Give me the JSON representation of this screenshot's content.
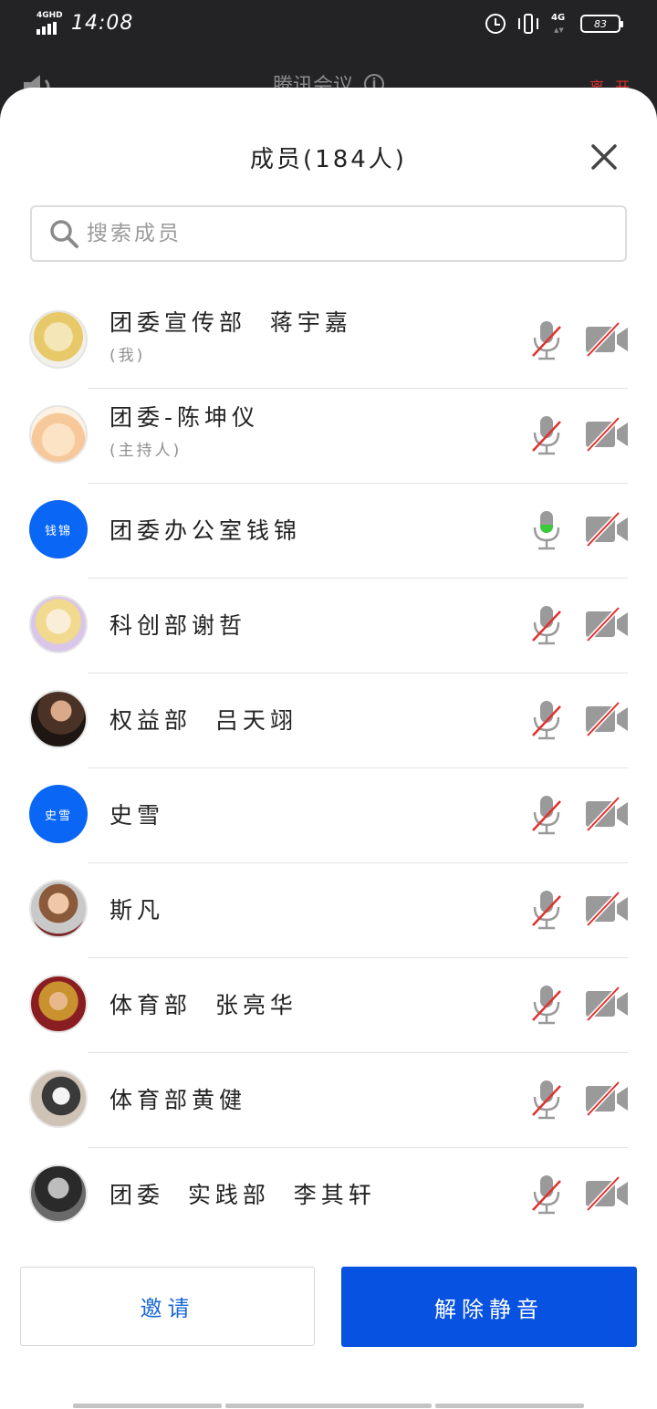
{
  "status_bar": {
    "network_label": "4GHD",
    "time": "14:08",
    "network_4g": "4G",
    "battery": "83"
  },
  "meeting": {
    "title": "腾讯会议",
    "leave_label": "离开"
  },
  "sheet": {
    "title": "成员(184人)",
    "search_placeholder": "搜索成员",
    "invite_label": "邀请",
    "unmute_label": "解除静音"
  },
  "colors": {
    "accent": "#0752e0",
    "avatar_blue": "#0a66f5",
    "muted_red": "#e0302d",
    "mic_active": "#3cc93c"
  },
  "members": [
    {
      "name": "团委宣传部  蒋宇嘉",
      "role": "(我)",
      "avatar": "anime-blonde",
      "mic": "muted",
      "camera": "off"
    },
    {
      "name": "团委-陈坤仪",
      "role": "(主持人)",
      "avatar": "anime-bunny",
      "mic": "muted",
      "camera": "off"
    },
    {
      "name": "团委办公室钱锦",
      "role": "",
      "avatar_text": "钱锦",
      "mic": "speaking",
      "camera": "off"
    },
    {
      "name": "科创部谢哲",
      "role": "",
      "avatar": "anime-sailor",
      "mic": "muted",
      "camera": "off"
    },
    {
      "name": "权益部  吕天翊",
      "role": "",
      "avatar": "photo-player",
      "mic": "muted",
      "camera": "off"
    },
    {
      "name": "史雪",
      "role": "",
      "avatar_text": "史雪",
      "mic": "muted",
      "camera": "off"
    },
    {
      "name": "斯凡",
      "role": "",
      "avatar": "photo-girl",
      "mic": "muted",
      "camera": "off"
    },
    {
      "name": "体育部  张亮华",
      "role": "",
      "avatar": "photo-redhair",
      "mic": "muted",
      "camera": "off"
    },
    {
      "name": "体育部黄健",
      "role": "",
      "avatar": "photo-dog",
      "mic": "muted",
      "camera": "off"
    },
    {
      "name": "团委  实践部  李其轩",
      "role": "",
      "avatar": "photo-bw-man",
      "mic": "muted",
      "camera": "off"
    }
  ]
}
